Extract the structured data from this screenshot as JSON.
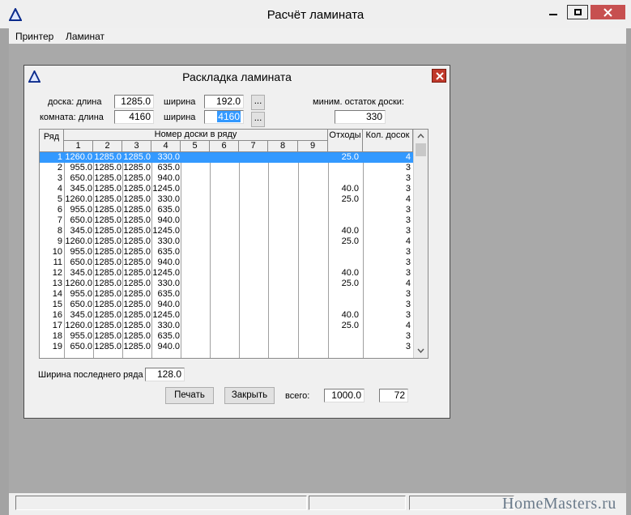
{
  "main_window": {
    "title": "Расчёт ламината",
    "menu": [
      "Принтер",
      "Ламинат"
    ]
  },
  "dialog": {
    "title": "Раскладка ламината",
    "board_label": "доска:  длина",
    "board_length": "1285.0",
    "width_label": "ширина",
    "board_width": "192.0",
    "room_label": "комната: длина",
    "room_length": "4160",
    "room_width": "4160",
    "browse_label": "...",
    "min_rest_label": "миним. остаток доски:",
    "min_rest_value": "330",
    "table": {
      "headers": {
        "row": "Ряд",
        "board_number": "Номер доски в ряду",
        "waste": "Отходы",
        "board_count": "Кол. досок",
        "numbers": [
          "1",
          "2",
          "3",
          "4",
          "5",
          "6",
          "7",
          "8",
          "9"
        ]
      },
      "rows": [
        {
          "n": "1",
          "b1": "1260.0",
          "b2": "1285.0",
          "b3": "1285.0",
          "b4": "330.0",
          "waste": "25.0",
          "count": "4"
        },
        {
          "n": "2",
          "b1": "955.0",
          "b2": "1285.0",
          "b3": "1285.0",
          "b4": "635.0",
          "waste": "",
          "count": "3"
        },
        {
          "n": "3",
          "b1": "650.0",
          "b2": "1285.0",
          "b3": "1285.0",
          "b4": "940.0",
          "waste": "",
          "count": "3"
        },
        {
          "n": "4",
          "b1": "345.0",
          "b2": "1285.0",
          "b3": "1285.0",
          "b4": "1245.0",
          "waste": "40.0",
          "count": "3"
        },
        {
          "n": "5",
          "b1": "1260.0",
          "b2": "1285.0",
          "b3": "1285.0",
          "b4": "330.0",
          "waste": "25.0",
          "count": "4"
        },
        {
          "n": "6",
          "b1": "955.0",
          "b2": "1285.0",
          "b3": "1285.0",
          "b4": "635.0",
          "waste": "",
          "count": "3"
        },
        {
          "n": "7",
          "b1": "650.0",
          "b2": "1285.0",
          "b3": "1285.0",
          "b4": "940.0",
          "waste": "",
          "count": "3"
        },
        {
          "n": "8",
          "b1": "345.0",
          "b2": "1285.0",
          "b3": "1285.0",
          "b4": "1245.0",
          "waste": "40.0",
          "count": "3"
        },
        {
          "n": "9",
          "b1": "1260.0",
          "b2": "1285.0",
          "b3": "1285.0",
          "b4": "330.0",
          "waste": "25.0",
          "count": "4"
        },
        {
          "n": "10",
          "b1": "955.0",
          "b2": "1285.0",
          "b3": "1285.0",
          "b4": "635.0",
          "waste": "",
          "count": "3"
        },
        {
          "n": "11",
          "b1": "650.0",
          "b2": "1285.0",
          "b3": "1285.0",
          "b4": "940.0",
          "waste": "",
          "count": "3"
        },
        {
          "n": "12",
          "b1": "345.0",
          "b2": "1285.0",
          "b3": "1285.0",
          "b4": "1245.0",
          "waste": "40.0",
          "count": "3"
        },
        {
          "n": "13",
          "b1": "1260.0",
          "b2": "1285.0",
          "b3": "1285.0",
          "b4": "330.0",
          "waste": "25.0",
          "count": "4"
        },
        {
          "n": "14",
          "b1": "955.0",
          "b2": "1285.0",
          "b3": "1285.0",
          "b4": "635.0",
          "waste": "",
          "count": "3"
        },
        {
          "n": "15",
          "b1": "650.0",
          "b2": "1285.0",
          "b3": "1285.0",
          "b4": "940.0",
          "waste": "",
          "count": "3"
        },
        {
          "n": "16",
          "b1": "345.0",
          "b2": "1285.0",
          "b3": "1285.0",
          "b4": "1245.0",
          "waste": "40.0",
          "count": "3"
        },
        {
          "n": "17",
          "b1": "1260.0",
          "b2": "1285.0",
          "b3": "1285.0",
          "b4": "330.0",
          "waste": "25.0",
          "count": "4"
        },
        {
          "n": "18",
          "b1": "955.0",
          "b2": "1285.0",
          "b3": "1285.0",
          "b4": "635.0",
          "waste": "",
          "count": "3"
        },
        {
          "n": "19",
          "b1": "650.0",
          "b2": "1285.0",
          "b3": "1285.0",
          "b4": "940.0",
          "waste": "",
          "count": "3"
        }
      ]
    },
    "last_row_label": "Ширина последнего ряда",
    "last_row_value": "128.0",
    "print_button": "Печать",
    "close_button": "Закрыть",
    "total_label": "всего:",
    "total_length": "1000.0",
    "total_count": "72"
  },
  "watermark": "HomeMasters.ru",
  "colors": {
    "selection": "#3399ff",
    "close_red": "#c0392b",
    "desktop": "#a3a3a3"
  }
}
